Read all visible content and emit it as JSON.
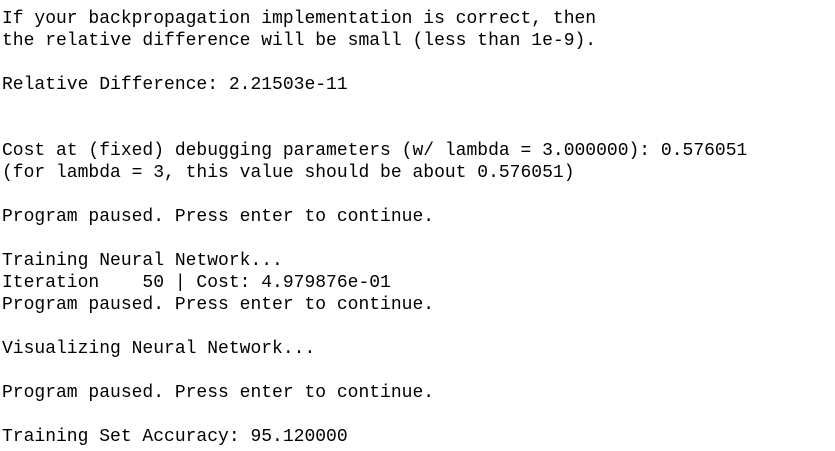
{
  "console": {
    "lines": [
      "If your backpropagation implementation is correct, then",
      "the relative difference will be small (less than 1e-9).",
      "",
      "Relative Difference: 2.21503e-11",
      "",
      "",
      "Cost at (fixed) debugging parameters (w/ lambda = 3.000000): 0.576051",
      "(for lambda = 3, this value should be about 0.576051)",
      "",
      "Program paused. Press enter to continue.",
      "",
      "Training Neural Network...",
      "Iteration    50 | Cost: 4.979876e-01",
      "Program paused. Press enter to continue.",
      "",
      "Visualizing Neural Network...",
      "",
      "Program paused. Press enter to continue.",
      "",
      "Training Set Accuracy: 95.120000"
    ]
  }
}
